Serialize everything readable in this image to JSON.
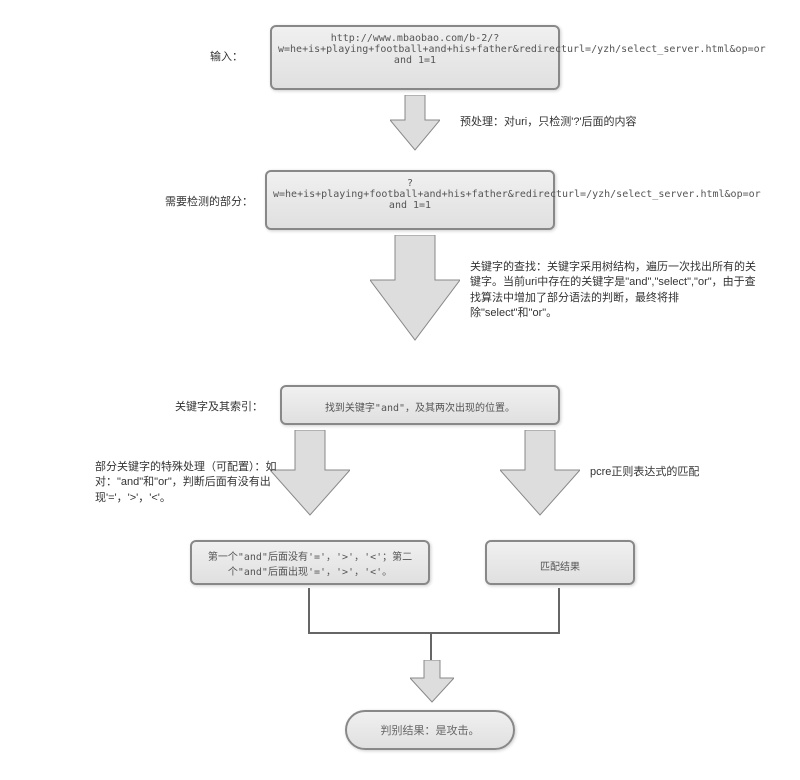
{
  "labels": {
    "input": "输入：",
    "preprocess": "预处理：对uri，只检测'?'后面的内容",
    "detect": "需要检测的部分：",
    "keyword_search": "关键字的查找：关键字采用树结构，遍历一次找出所有的关键字。当前uri中存在的关键字是\"and\",\"select\",\"or\"，由于查找算法中增加了部分语法的判断，最终将排除\"select\"和\"or\"。",
    "keyword_index": "关键字及其索引：",
    "special": "部分关键字的特殊处理（可配置）：如对：\"and\"和\"or\"，判断后面有没有出现'='，'>'，'<'。",
    "pcre": "pcre正则表达式的匹配"
  },
  "boxes": {
    "input": "http://www.mbaobao.com/b-2/?w=he+is+playing+football+and+his+father&redirecturl=/yzh/select_server.html&op=or and 1=1",
    "detect": "?w=he+is+playing+football+and+his+father&redirecturl=/yzh/select_server.html&op=or and 1=1",
    "keyword": "找到关键字\"and\"，及其两次出现的位置。",
    "special_result": "第一个\"and\"后面没有'='，'>'，'<'；第二个\"and\"后面出现'='，'>'，'<'。",
    "match_result": "匹配结果"
  },
  "oval": {
    "result": "判别结果：是攻击。"
  }
}
